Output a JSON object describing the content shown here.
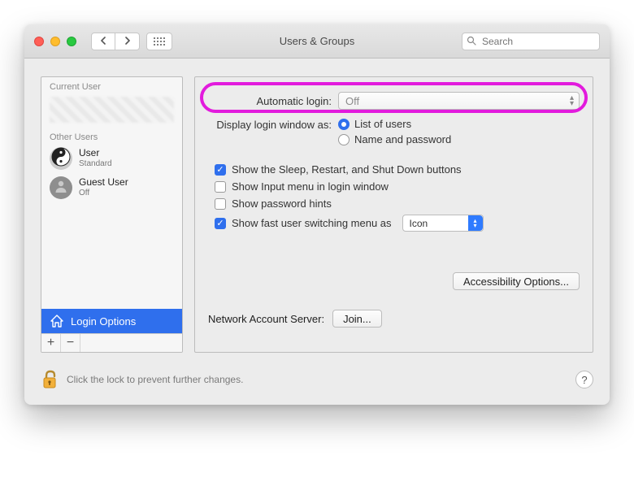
{
  "titlebar": {
    "title": "Users & Groups",
    "search_placeholder": "Search"
  },
  "sidebar": {
    "current_header": "Current User",
    "other_header": "Other Users",
    "users": [
      {
        "name": "User",
        "subtitle": "Standard",
        "avatar": "yinyang"
      },
      {
        "name": "Guest User",
        "subtitle": "Off",
        "avatar": "silhouette"
      }
    ],
    "login_options_label": "Login Options"
  },
  "main": {
    "auto_login_label": "Automatic login:",
    "auto_login_value": "Off",
    "display_login_label": "Display login window as:",
    "radio_list_label": "List of users",
    "radio_namepw_label": "Name and password",
    "chk_sleep_label": "Show the Sleep, Restart, and Shut Down buttons",
    "chk_input_label": "Show Input menu in login window",
    "chk_pwhints_label": "Show password hints",
    "chk_fastswitch_label": "Show fast user switching menu as",
    "fastswitch_value": "Icon",
    "accessibility_btn": "Accessibility Options...",
    "nas_label": "Network Account Server:",
    "join_btn": "Join..."
  },
  "footer": {
    "lock_text": "Click the lock to prevent further changes."
  },
  "highlight": {
    "color": "#e21bdd"
  }
}
